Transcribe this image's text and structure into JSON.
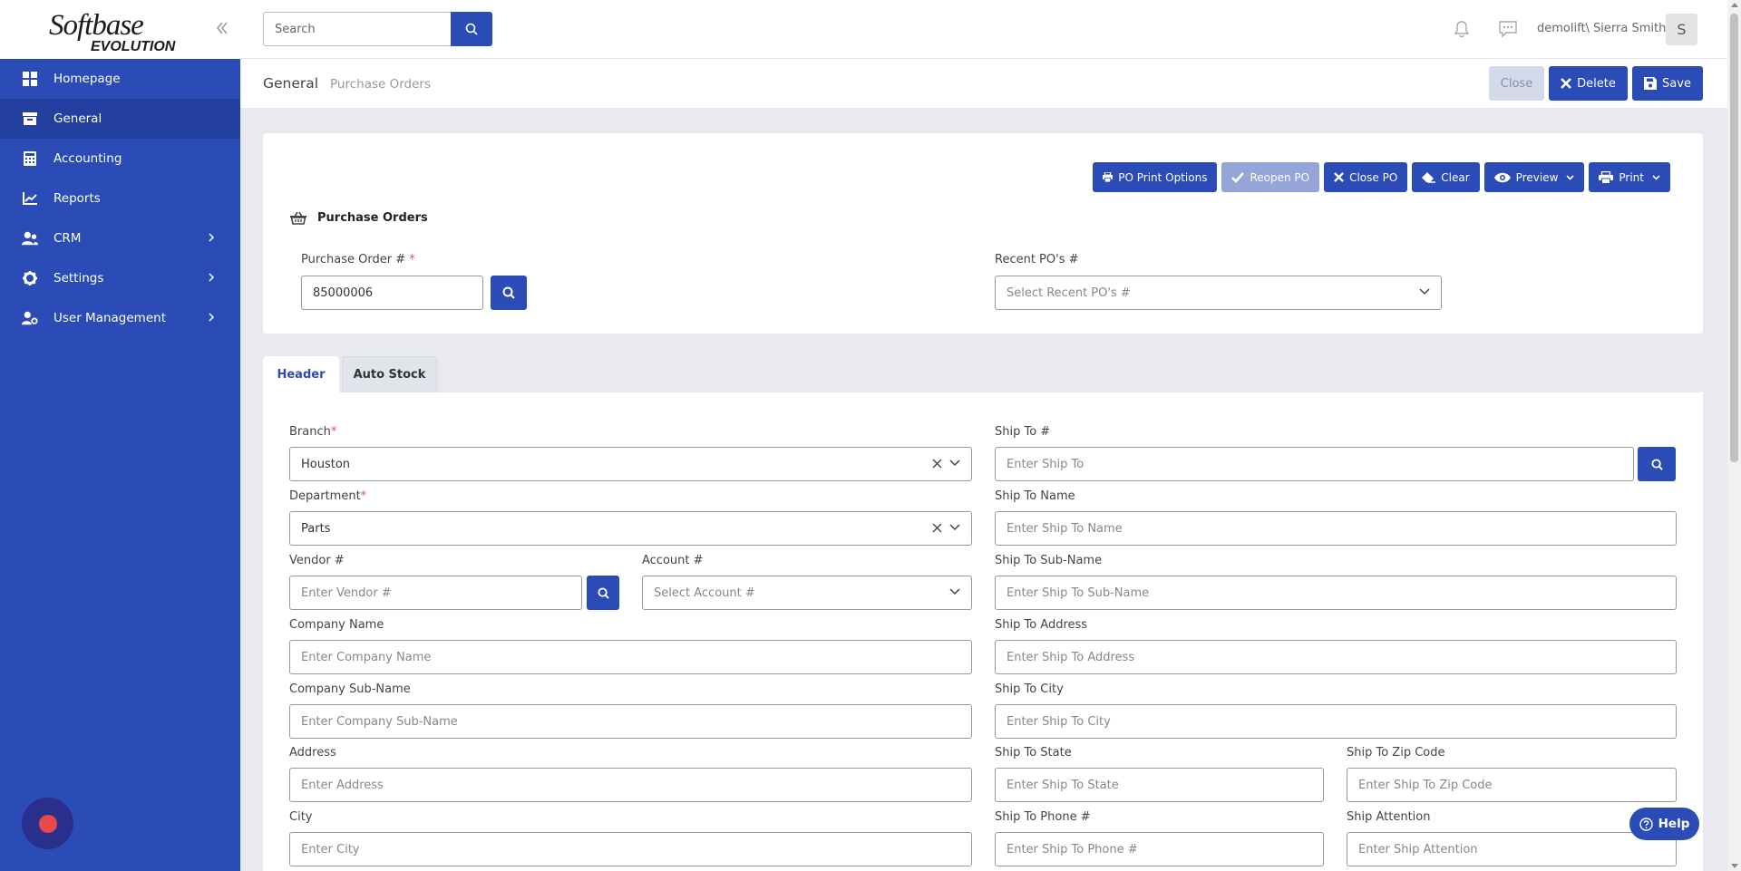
{
  "brand": {
    "line1": "Softbase",
    "line2": "EVOLUTION"
  },
  "sidebar": {
    "items": [
      {
        "label": "Homepage",
        "icon": "grid-icon"
      },
      {
        "label": "General",
        "icon": "archive-icon"
      },
      {
        "label": "Accounting",
        "icon": "calculator-icon"
      },
      {
        "label": "Reports",
        "icon": "chart-icon"
      },
      {
        "label": "CRM",
        "icon": "users-icon"
      },
      {
        "label": "Settings",
        "icon": "gear-icon"
      },
      {
        "label": "User Management",
        "icon": "user-gear-icon"
      }
    ]
  },
  "topbar": {
    "search_placeholder": "Search",
    "username": "demolift\\ Sierra Smith",
    "avatar_initial": "S"
  },
  "breadcrumb": {
    "section": "General",
    "page": "Purchase Orders"
  },
  "actions": {
    "close": "Close",
    "delete": "Delete",
    "save": "Save"
  },
  "toolbar": {
    "print_options": "PO Print Options",
    "reopen": "Reopen PO",
    "close_po": "Close PO",
    "clear": "Clear",
    "preview": "Preview",
    "print": "Print"
  },
  "po_card": {
    "title": "Purchase Orders",
    "po_label": "Purchase Order #",
    "po_value": "85000006",
    "recent_label": "Recent PO's #",
    "recent_placeholder": "Select Recent PO's #"
  },
  "tabs": {
    "header": "Header",
    "auto_stock": "Auto Stock"
  },
  "form": {
    "branch_label": "Branch",
    "branch_value": "Houston",
    "department_label": "Department",
    "department_value": "Parts",
    "vendor_label": "Vendor #",
    "vendor_placeholder": "Enter Vendor #",
    "account_label": "Account #",
    "account_placeholder": "Select Account #",
    "company_label": "Company Name",
    "company_placeholder": "Enter Company Name",
    "company_sub_label": "Company Sub-Name",
    "company_sub_placeholder": "Enter Company Sub-Name",
    "address_label": "Address",
    "address_placeholder": "Enter Address",
    "city_label": "City",
    "city_placeholder": "Enter City",
    "ship_to_label": "Ship To #",
    "ship_to_placeholder": "Enter Ship To",
    "ship_name_label": "Ship To Name",
    "ship_name_placeholder": "Enter Ship To Name",
    "ship_sub_label": "Ship To Sub-Name",
    "ship_sub_placeholder": "Enter Ship To Sub-Name",
    "ship_address_label": "Ship To Address",
    "ship_address_placeholder": "Enter Ship To Address",
    "ship_city_label": "Ship To City",
    "ship_city_placeholder": "Enter Ship To City",
    "ship_state_label": "Ship To State",
    "ship_state_placeholder": "Enter Ship To State",
    "ship_zip_label": "Ship To Zip Code",
    "ship_zip_placeholder": "Enter Ship To Zip Code",
    "ship_phone_label": "Ship To Phone #",
    "ship_phone_placeholder": "Enter Ship To Phone #",
    "ship_attn_label": "Ship Attention",
    "ship_attn_placeholder": "Enter Ship Attention"
  },
  "help": {
    "label": "Help"
  },
  "colors": {
    "primary": "#2b4bb6",
    "sidebar_active": "#2340a1",
    "required": "#d9534f"
  }
}
